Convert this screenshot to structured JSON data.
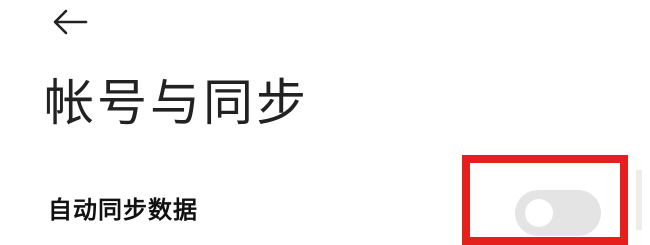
{
  "header": {
    "back_icon": "arrow-left-icon",
    "title": "帐号与同步"
  },
  "settings": [
    {
      "label": "自动同步数据",
      "toggle_on": false
    }
  ],
  "colors": {
    "highlight": "#e5201c",
    "toggle_track_off": "#e4e4e4",
    "toggle_knob": "#ffffff"
  }
}
